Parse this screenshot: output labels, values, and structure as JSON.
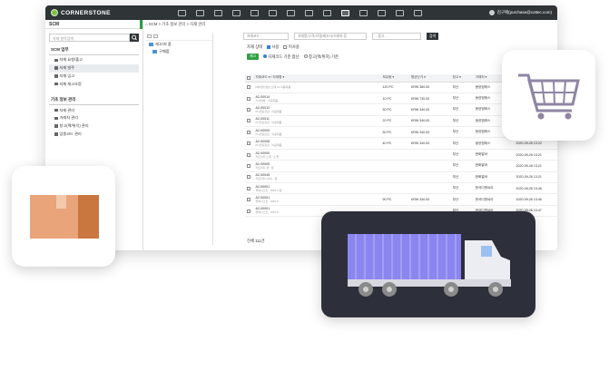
{
  "app": {
    "logo_text": "CORNERSTONE",
    "user_email": "김구매(purchase@cottec.com)"
  },
  "colors": {
    "accent": "#2f9e44",
    "dark": "#2f3437",
    "link": "#3b7ddd",
    "truck_card": "#2d2f3a",
    "truck_body": "#8b85f0"
  },
  "sidebar": {
    "title": "SCM",
    "search_placeholder": "자재 항목검색",
    "groups": [
      {
        "label": "SCM 업무",
        "items": [
          "자재 요청/출고",
          "자재 발주",
          "자재 입고",
          "자재 재고조정"
        ]
      },
      {
        "label": "기초 정보 관리",
        "items": [
          "자재 관리",
          "거래처 관리",
          "창고(랙/위치) 관리",
          "업종코드 관리"
        ]
      }
    ]
  },
  "breadcrumb": "⌂ SCM > 기초 정보 관리 > 자재 관리",
  "tree": {
    "root": "재고/처 품",
    "child": "구매품"
  },
  "filters": {
    "code_placeholder": "자재코드",
    "name_placeholder": "자재명/규격/모델/제조사/거래처 등",
    "select_value": "- 창고 -",
    "search_label": "검색"
  },
  "status": {
    "label": "자재 상태",
    "options": [
      "사용",
      "미사용"
    ]
  },
  "stock_filter": {
    "badge": "재고",
    "options": [
      "자재코드 기준 합산",
      "창고(랙/위치) 기준"
    ]
  },
  "table": {
    "headers": [
      "",
      "자재코드 ▾ / 자재명 ▾",
      "",
      "보유량 ▾",
      "평균단가 ▾",
      "창고 ▾",
      "거래처 ▾",
      "",
      ""
    ],
    "rows": [
      {
        "code": "",
        "name": "[에이형] 일반 소재 12 이웅제품",
        "qty": "120 PC",
        "price": "KRW 360.00",
        "wh": "부산",
        "vendor": "동양엠에스",
        "date": "2020-09-26 13:20"
      },
      {
        "code": "A2-00014",
        "name": "가서쌍밤 · 이웅제품",
        "qty": "10 PC",
        "price": "KRW 730.00",
        "wh": "부산",
        "vendor": "동양엠에스",
        "date": "2020-09-26 13:21"
      },
      {
        "code": "A2-00012",
        "name": "PU코팅장갑 · 이웅제품",
        "qty": "50 PC",
        "price": "KRW 340.00",
        "wh": "부산",
        "vendor": "동양엠에스",
        "date": "2020-09-26 13:21"
      },
      {
        "code": "A2-00011",
        "name": "PU코팅장갑 · 이웅제품",
        "qty": "20 PC",
        "price": "KRW 340.00",
        "wh": "부산",
        "vendor": "동양엠에스",
        "date": "2020-09-26 13:22"
      },
      {
        "code": "A2-00009",
        "name": "PU코팅장갑 · 이웅제품",
        "qty": "50 PC",
        "price": "KRW 340.00",
        "wh": "부산",
        "vendor": "동양엠에스",
        "date": "2020-09-26 13:22"
      },
      {
        "code": "A2-00008",
        "name": "PU코팅장갑 · 이웅제품",
        "qty": "40 PC",
        "price": "KRW 340.00",
        "wh": "부산",
        "vendor": "동양엠에스",
        "date": "2020-09-26 13:22"
      },
      {
        "code": "A2-00000",
        "name": "카트리지 노즐 · 노즐",
        "qty": "",
        "price": "",
        "wh": "부산",
        "vendor": "한화알바",
        "date": "2020-09-26 13:21"
      },
      {
        "code": "A2-00005",
        "name": "카트리지 캡 · 캡",
        "qty": "",
        "price": "",
        "wh": "부산",
        "vendor": "한화알바",
        "date": "2020-09-26 13:21"
      },
      {
        "code": "A2-00045",
        "name": "카트리지 (4리) · 캡",
        "qty": "",
        "price": "",
        "wh": "부산",
        "vendor": "한화알바",
        "date": "2020-09-26 13:21"
      },
      {
        "code": "A2-00001",
        "name": "플렉시스트 · WP1.5 등",
        "qty": "",
        "price": "",
        "wh": "부산",
        "vendor": "한국디엔씨아",
        "date": "2020-09-26 13:46"
      },
      {
        "code": "A2-00001",
        "name": "플렉시스트 · WP1.5",
        "qty": "90 PC",
        "price": "KRW 340.00",
        "wh": "부산",
        "vendor": "한국디엔씨아",
        "date": "2020-09-26 13:46"
      },
      {
        "code": "A2-00001",
        "name": "플렉시스트 · WP1.5",
        "qty": "",
        "price": "",
        "wh": "부산",
        "vendor": "한국디엔씨아",
        "date": "2020-09-26 13:47"
      }
    ]
  },
  "total": "전체 111건",
  "icons": {
    "box": "package-box-icon",
    "cart": "shopping-cart-icon",
    "truck": "delivery-truck-icon"
  }
}
